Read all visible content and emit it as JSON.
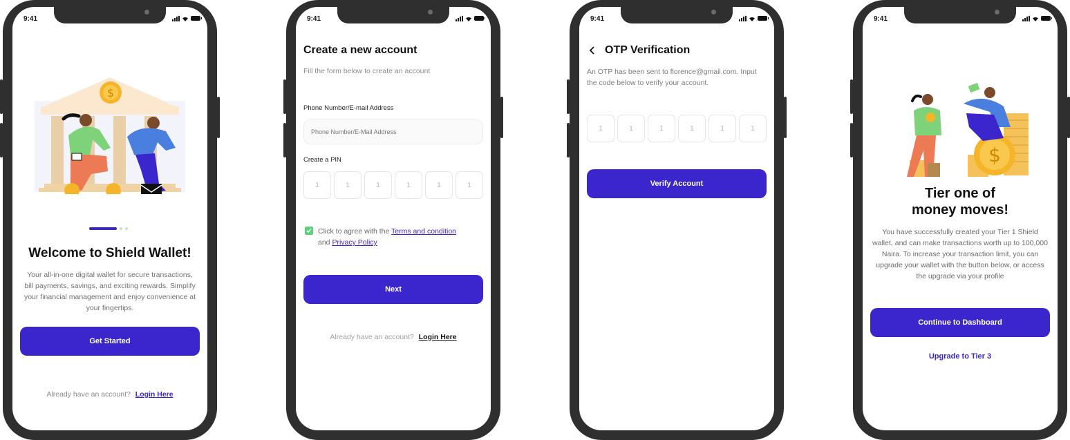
{
  "status_bar": {
    "time": "9:41"
  },
  "screens": {
    "welcome": {
      "title": "Welcome to Shield Wallet!",
      "description": "Your all-in-one digital wallet for secure transactions, bill payments, savings, and exciting rewards. Simplify your financial management and enjoy convenience at your fingertips.",
      "cta": "Get Started",
      "login_prompt": "Already have an account?",
      "login_link": "Login Here",
      "pager": {
        "count": 3,
        "active": 0
      }
    },
    "signup": {
      "title": "Create a new account",
      "subtitle": "Fill the form below to create an account",
      "phone_label": "Phone Number/E-mail Address",
      "phone_placeholder": "Phone Number/E-Mail Address",
      "pin_label": "Create a PIN",
      "pin_digits": [
        "1",
        "1",
        "1",
        "1",
        "1",
        "1"
      ],
      "agree_prefix": "Click to agree with the",
      "terms_link": "Terms and condition",
      "agree_and": "and",
      "privacy_link": "Privacy Policy",
      "agree_checked": true,
      "cta": "Next",
      "login_prompt": "Already have an account?",
      "login_link": "Login Here"
    },
    "otp": {
      "title": "OTP Verification",
      "description": "An OTP has been sent to florence@gmail.com. Input the code below to verify your account.",
      "otp_digits": [
        "1",
        "1",
        "1",
        "1",
        "1",
        "1"
      ],
      "cta": "Verify Account"
    },
    "success": {
      "title": "Tier one of money moves!",
      "description": "You have successfully created your Tier 1 Shield wallet, and can make transactions worth up to 100,000 Naira. To increase your transaction limit, you can upgrade your wallet with the button below, or access the upgrade via your profile",
      "cta": "Continue to Dashboard",
      "secondary_link": "Upgrade to Tier 3"
    }
  },
  "colors": {
    "primary": "#3a26cc",
    "frame": "#2f2f2f",
    "checkbox": "#5fd07a",
    "link": "#3a26cc"
  }
}
